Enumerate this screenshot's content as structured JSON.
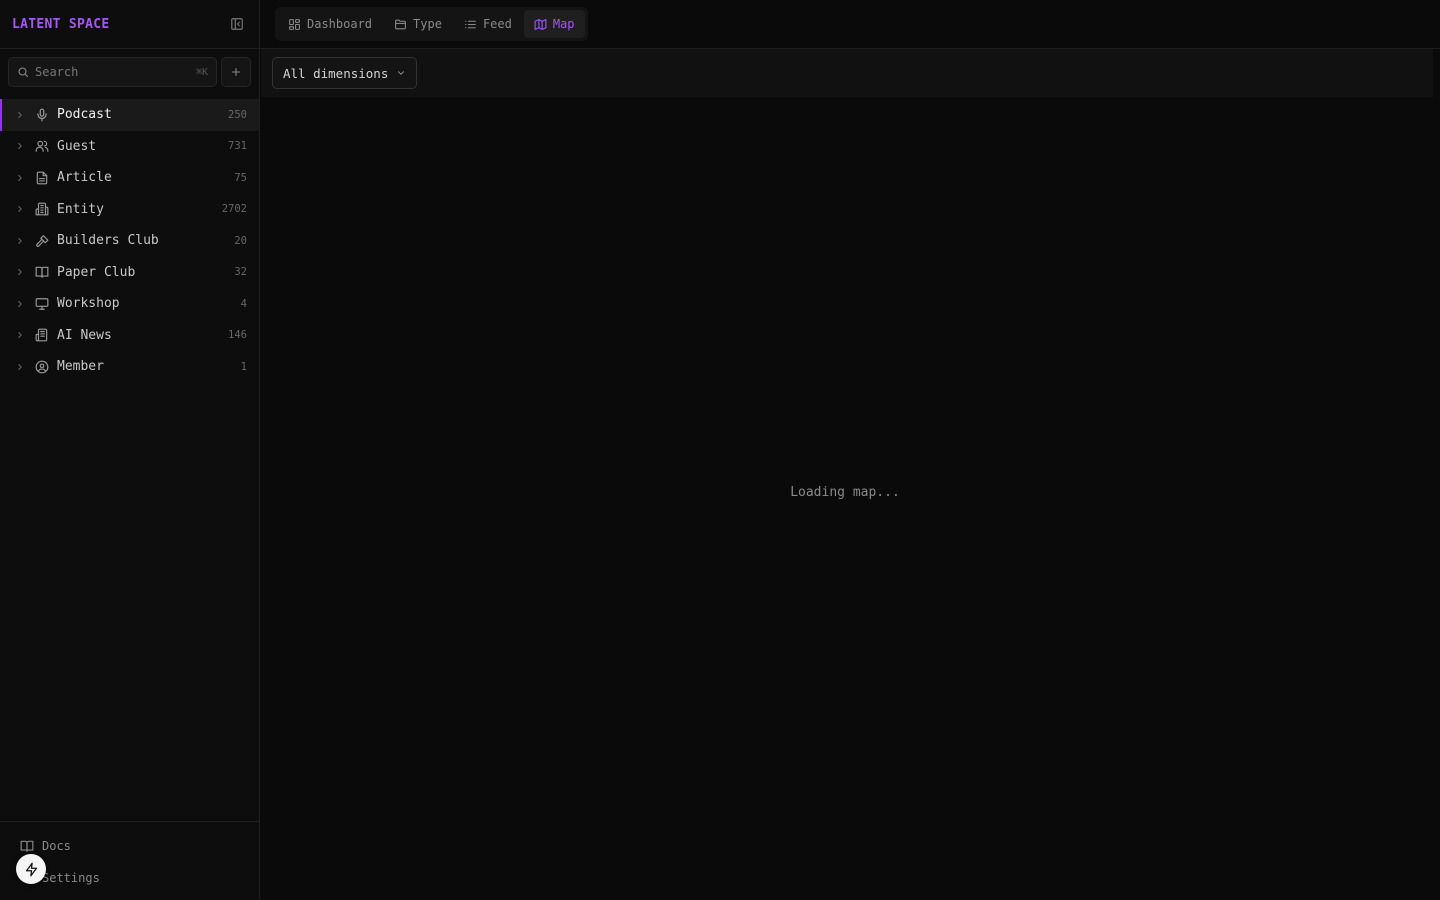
{
  "brand": "LATENT SPACE",
  "search": {
    "placeholder": "Search",
    "shortcut": "⌘K"
  },
  "sidebar": {
    "items": [
      {
        "label": "Podcast",
        "count": "250",
        "icon": "mic-icon",
        "active": true
      },
      {
        "label": "Guest",
        "count": "731",
        "icon": "users-icon"
      },
      {
        "label": "Article",
        "count": "75",
        "icon": "file-text-icon"
      },
      {
        "label": "Entity",
        "count": "2702",
        "icon": "building-icon"
      },
      {
        "label": "Builders Club",
        "count": "20",
        "icon": "hammer-icon"
      },
      {
        "label": "Paper Club",
        "count": "32",
        "icon": "book-open-icon"
      },
      {
        "label": "Workshop",
        "count": "4",
        "icon": "presentation-icon"
      },
      {
        "label": "AI News",
        "count": "146",
        "icon": "newspaper-icon"
      },
      {
        "label": "Member",
        "count": "1",
        "icon": "user-circle-icon"
      }
    ]
  },
  "footer": {
    "docs_label": "Docs",
    "settings_label": "Settings"
  },
  "tabs": [
    {
      "label": "Dashboard",
      "icon": "grid-icon"
    },
    {
      "label": "Type",
      "icon": "folder-icon"
    },
    {
      "label": "Feed",
      "icon": "list-icon"
    },
    {
      "label": "Map",
      "icon": "map-icon",
      "active": true
    }
  ],
  "filter": {
    "dropdown_label": "All dimensions"
  },
  "map": {
    "loading_text": "Loading map..."
  },
  "colors": {
    "accent": "#a855f7",
    "active_bar": "#9333ea",
    "background": "#0a0a0a"
  }
}
